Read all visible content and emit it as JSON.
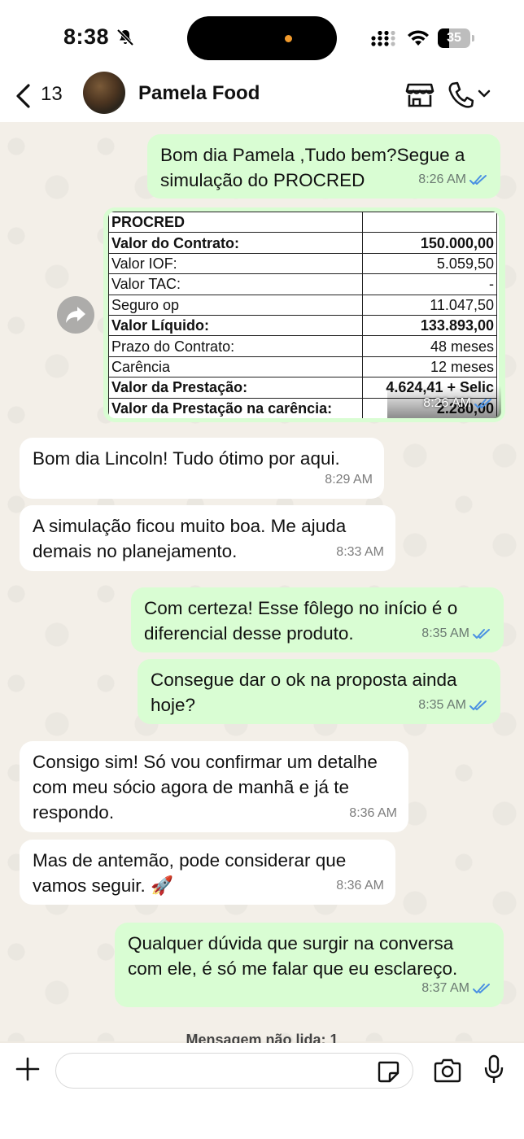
{
  "status_bar": {
    "time": "8:38",
    "battery": "35",
    "battery_level": 0.35
  },
  "header": {
    "back_count": "13",
    "contact_name": "Pamela Food"
  },
  "messages": [
    {
      "text": "Bom dia Pamela ,Tudo bem?Segue a simulação do PROCRED",
      "time": "8:26 AM",
      "direction": "out"
    },
    {
      "text": "Bom dia Lincoln! Tudo ótimo por aqui.",
      "time": "8:29 AM",
      "direction": "in"
    },
    {
      "text": "A simulação ficou muito boa. Me ajuda demais no planejamento.",
      "time": "8:33 AM",
      "direction": "in"
    },
    {
      "text": "Com certeza! Esse fôlego no início é o diferencial desse produto.",
      "time": "8:35 AM",
      "direction": "out"
    },
    {
      "text": "Consegue dar o ok na proposta ainda hoje?",
      "time": "8:35 AM",
      "direction": "out"
    },
    {
      "text": "Consigo sim! Só vou confirmar um detalhe com meu sócio agora de manhã e já te respondo.",
      "time": "8:36 AM",
      "direction": "in"
    },
    {
      "text": "Mas de antemão, pode considerar que vamos seguir. 🚀",
      "time": "8:36 AM",
      "direction": "in"
    },
    {
      "text": "Qualquer dúvida que surgir na conversa com ele, é só me falar que eu esclareço.",
      "time": "8:37 AM",
      "direction": "out"
    }
  ],
  "image_message": {
    "time": "8:26 AM",
    "table": [
      {
        "label": "PROCRED",
        "value": "",
        "bold": true
      },
      {
        "label": "Valor do Contrato:",
        "value": "150.000,00",
        "bold": true
      },
      {
        "label": "Valor IOF:",
        "value": "5.059,50",
        "bold": false
      },
      {
        "label": "Valor TAC:",
        "value": "-",
        "bold": false
      },
      {
        "label": "Seguro op",
        "value": "11.047,50",
        "bold": false
      },
      {
        "label": "Valor Líquido:",
        "value": "133.893,00",
        "bold": true
      },
      {
        "label": "Prazo do Contrato:",
        "value": "48 meses",
        "bold": false
      },
      {
        "label": "Carência",
        "value": "12 meses",
        "bold": false
      },
      {
        "label": "Valor da Prestação:",
        "value": "4.624,41 + Selic",
        "bold": true
      },
      {
        "label": "Valor da Prestação na carência:",
        "value": "2.280,00",
        "bold": true
      }
    ]
  },
  "unread_label": "Mensagem não lida: 1",
  "colors": {
    "outgoing_bubble": "#d9fdd3",
    "incoming_bubble": "#ffffff",
    "read_ticks": "#4a90e2"
  },
  "icons": [
    "bell-slash-icon",
    "signal-icon",
    "wifi-icon",
    "battery-icon",
    "back-chevron-icon",
    "store-icon",
    "phone-icon",
    "chevron-down-icon",
    "forward-icon",
    "plus-icon",
    "sticker-icon",
    "camera-icon",
    "mic-icon"
  ]
}
